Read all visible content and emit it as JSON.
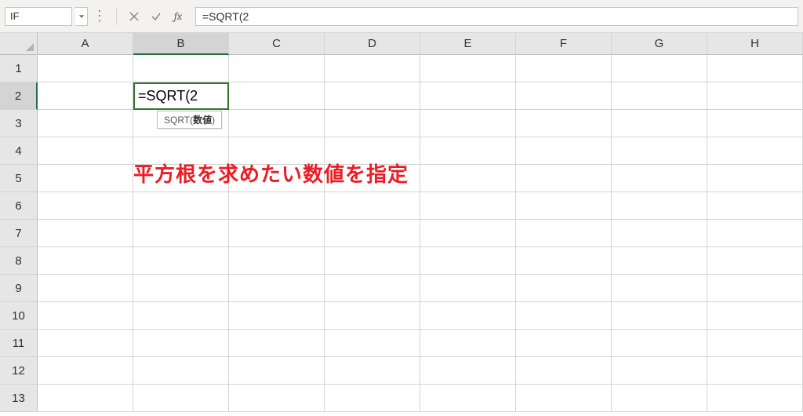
{
  "formulaBar": {
    "nameBox": "IF",
    "formula": "=SQRT(2"
  },
  "columns": [
    "A",
    "B",
    "C",
    "D",
    "E",
    "F",
    "G",
    "H"
  ],
  "activeColumnIndex": 1,
  "rows": [
    "1",
    "2",
    "3",
    "4",
    "5",
    "6",
    "7",
    "8",
    "9",
    "10",
    "11",
    "12",
    "13"
  ],
  "activeRowIndex": 1,
  "editingCell": {
    "value": "=SQRT(2"
  },
  "tooltip": {
    "func": "SQRT(",
    "arg": "数値",
    "close": ")"
  },
  "annotation": "平方根を求めたい数値を指定"
}
